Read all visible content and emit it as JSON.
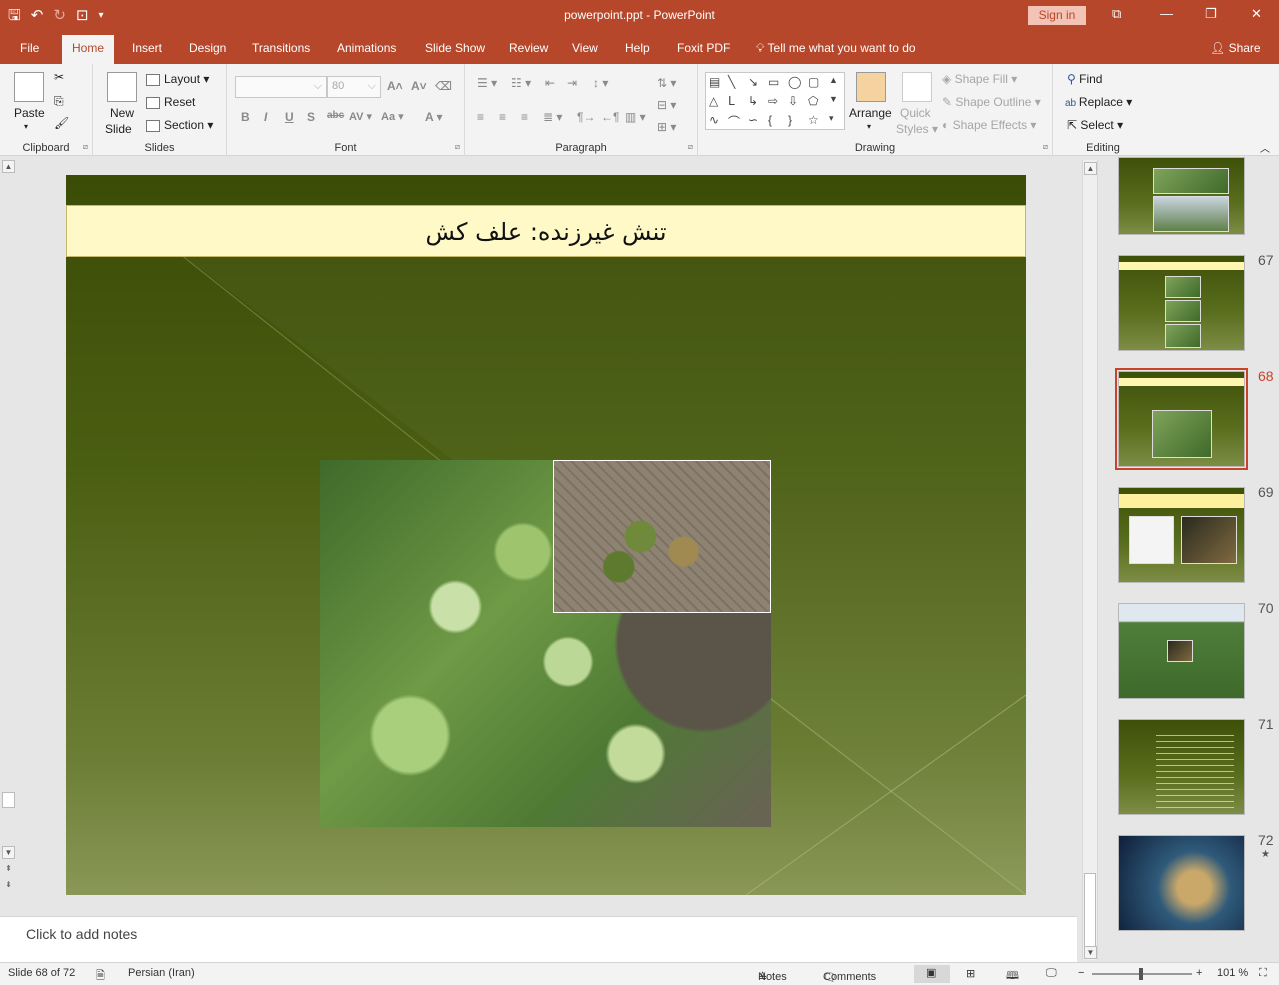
{
  "window": {
    "title": "powerpoint.ppt  -  PowerPoint",
    "signin": "Sign in"
  },
  "tabs": [
    "File",
    "Home",
    "Insert",
    "Design",
    "Transitions",
    "Animations",
    "Slide Show",
    "Review",
    "View",
    "Help",
    "Foxit PDF"
  ],
  "tellme": "Tell me what you want to do",
  "share": "Share",
  "ribbon": {
    "clipboard": {
      "label": "Clipboard",
      "paste": "Paste"
    },
    "slides": {
      "label": "Slides",
      "new_slide": "New",
      "new_slide2": "Slide",
      "layout": "Layout",
      "reset": "Reset",
      "section": "Section"
    },
    "font": {
      "label": "Font",
      "size": "80"
    },
    "paragraph": {
      "label": "Paragraph"
    },
    "drawing": {
      "label": "Drawing",
      "arrange": "Arrange",
      "quick_styles": "Quick",
      "quick_styles2": "Styles",
      "shape_fill": "Shape Fill",
      "shape_outline": "Shape Outline",
      "shape_effects": "Shape Effects"
    },
    "editing": {
      "label": "Editing",
      "find": "Find",
      "replace": "Replace",
      "select": "Select"
    }
  },
  "slide": {
    "title": "تنش غیرزنده: علف کش"
  },
  "notes": {
    "placeholder": "Click to add notes"
  },
  "thumbnails": [
    {
      "num": "67"
    },
    {
      "num": "68"
    },
    {
      "num": "69"
    },
    {
      "num": "70"
    },
    {
      "num": "71"
    },
    {
      "num": "72"
    }
  ],
  "status": {
    "slide": "Slide 68 of 72",
    "language": "Persian (Iran)",
    "notes": "Notes",
    "comments": "Comments",
    "zoom": "101 %"
  },
  "colors": {
    "accent": "#b7472a",
    "selected_outline": "#c9432a"
  }
}
